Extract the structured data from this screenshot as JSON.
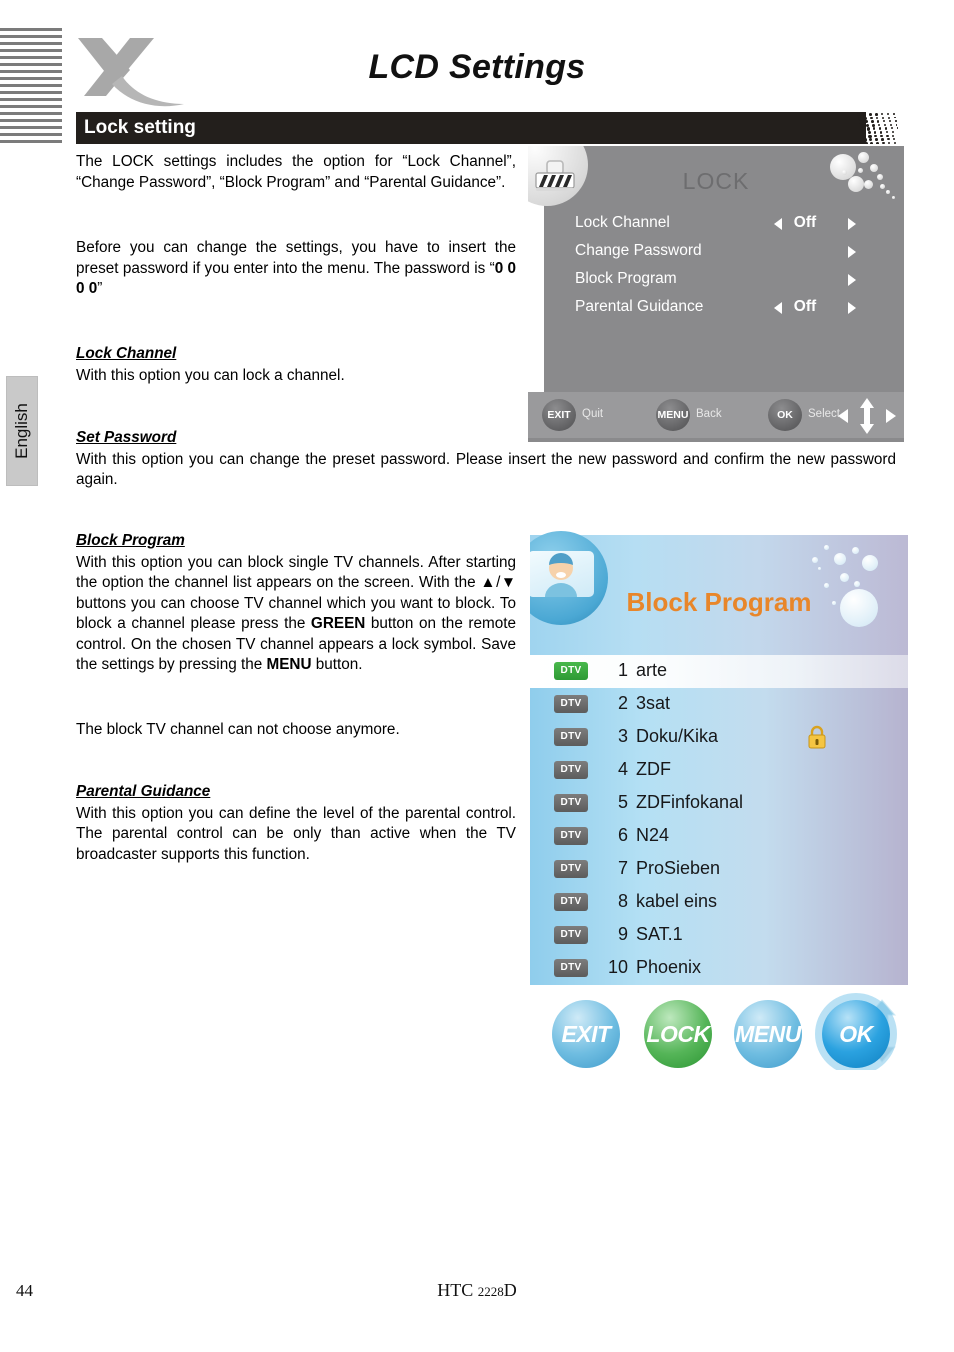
{
  "page": {
    "title": "LCD Settings",
    "section_heading": "Lock setting",
    "language_tab": "English",
    "page_number": "44",
    "model_prefix": "HTC ",
    "model_number": "2228",
    "model_suffix": "D"
  },
  "body": {
    "intro_p1": "The LOCK settings includes the option for “Lock Channel”, “Change Password”, “Block Program” and “Parental Guidance”.",
    "intro_p2_a": "Before you can change the settings, you have to insert the preset password if you enter into the menu. The password is “",
    "intro_p2_bold": "0 0 0 0",
    "intro_p2_b": "”",
    "lock_channel_heading": "Lock Channel",
    "lock_channel_text": "With this option you can lock a channel.",
    "set_password_heading": "Set Password",
    "set_password_text": "With this option you can change the preset password. Please insert the new password and confirm the new password again.",
    "block_program_heading": "Block Program",
    "block_program_text_a": "With this option you can block single TV channels. After starting the option the channel list appears on the screen. With the ▲/▼ buttons you can choose TV channel which you want to block. To block a channel please press the ",
    "block_program_green": "GREEN",
    "block_program_text_b": " button on the remote control. On the chosen TV channel appears a lock symbol. Save the settings by pressing the ",
    "block_program_menu": "MENU",
    "block_program_text_c": " button.",
    "block_program_note": "The block TV channel can not choose anymore.",
    "parental_heading": "Parental Guidance",
    "parental_text": "With this option you can define the level of the parental control. The parental control can be only than active when the TV broadcaster supports this function."
  },
  "osd_lock": {
    "title": "LOCK",
    "items": [
      {
        "label": "Lock Channel",
        "value": "Off",
        "has_arrows": true,
        "has_right_arrow": true
      },
      {
        "label": "Change Password",
        "value": "",
        "has_arrows": false,
        "has_right_arrow": true
      },
      {
        "label": "Block Program",
        "value": "",
        "has_arrows": false,
        "has_right_arrow": true
      },
      {
        "label": "Parental Guidance",
        "value": "Off",
        "has_arrows": true,
        "has_right_arrow": true
      }
    ],
    "footer": [
      {
        "key": "EXIT",
        "action": "Quit"
      },
      {
        "key": "MENU",
        "action": "Back"
      },
      {
        "key": "OK",
        "action": "Select"
      }
    ]
  },
  "osd_block": {
    "title": "Block Program",
    "title_color": "#e8862a",
    "channels": [
      {
        "type": "DTV",
        "number": "1",
        "name": "arte",
        "selected": true,
        "locked": false
      },
      {
        "type": "DTV",
        "number": "2",
        "name": "3sat",
        "selected": false,
        "locked": false
      },
      {
        "type": "DTV",
        "number": "3",
        "name": "Doku/Kika",
        "selected": false,
        "locked": true
      },
      {
        "type": "DTV",
        "number": "4",
        "name": "ZDF",
        "selected": false,
        "locked": false
      },
      {
        "type": "DTV",
        "number": "5",
        "name": "ZDFinfokanal",
        "selected": false,
        "locked": false
      },
      {
        "type": "DTV",
        "number": "6",
        "name": "N24",
        "selected": false,
        "locked": false
      },
      {
        "type": "DTV",
        "number": "7",
        "name": "ProSieben",
        "selected": false,
        "locked": false
      },
      {
        "type": "DTV",
        "number": "8",
        "name": "kabel eins",
        "selected": false,
        "locked": false
      },
      {
        "type": "DTV",
        "number": "9",
        "name": "SAT.1",
        "selected": false,
        "locked": false
      },
      {
        "type": "DTV",
        "number": "10",
        "name": "Phoenix",
        "selected": false,
        "locked": false
      }
    ],
    "buttons": [
      {
        "label": "EXIT",
        "color": "blue"
      },
      {
        "label": "LOCK",
        "color": "green"
      },
      {
        "label": "MENU",
        "color": "blue"
      },
      {
        "label": "OK",
        "color": "ok"
      }
    ]
  }
}
